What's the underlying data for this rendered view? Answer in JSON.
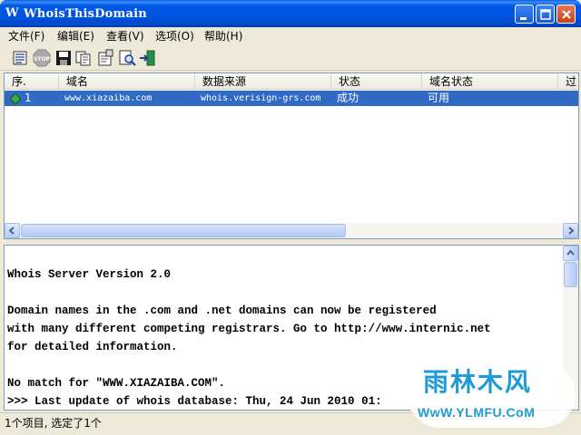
{
  "window": {
    "title": "WhoisThisDomain",
    "app_icon_glyph": "W",
    "accent_color": "#0054e3"
  },
  "menu": {
    "items": [
      {
        "label": "文件(F)"
      },
      {
        "label": "编辑(E)"
      },
      {
        "label": "查看(V)"
      },
      {
        "label": "选项(O)"
      },
      {
        "label": "帮助(H)"
      }
    ]
  },
  "toolbar": {
    "icons": [
      "list-icon",
      "stop-icon",
      "save-icon",
      "copy-icon",
      "properties-icon",
      "find-icon",
      "exit-icon"
    ]
  },
  "list": {
    "columns": [
      "序.",
      "域名",
      "数据来源",
      "状态",
      "域名状态",
      "过"
    ],
    "rows": [
      {
        "index": "1",
        "domain": "www.xiazaiba.com",
        "source": "whois.verisign-grs.com",
        "status": "成功",
        "domain_status": "可用"
      }
    ],
    "selected_color": "#316ac5"
  },
  "output": {
    "lines": [
      "Whois Server Version 2.0",
      "",
      "Domain names in the .com and .net domains can now be registered",
      "with many different competing registrars. Go to http://www.internic.net",
      "for detailed information.",
      "",
      "No match for \"WWW.XIAZAIBA.COM\".",
      ">>> Last update of whois database: Thu, 24 Jun 2010 01:"
    ]
  },
  "statusbar": {
    "text": "1个项目, 选定了1个"
  },
  "watermark": {
    "title": "雨林木风",
    "url": "WwW.YLMFU.CoM"
  }
}
